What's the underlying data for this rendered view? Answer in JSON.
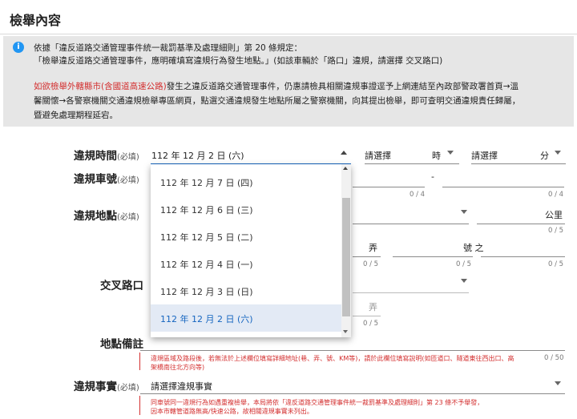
{
  "page": {
    "title": "檢舉內容"
  },
  "notice": {
    "line1": "依據「違反道路交通管理事件統一裁罰基準及處理細則」第 20 條規定：",
    "line2": "「檢舉違反道路交通管理事件，應明確填寫違規行為發生地點。」(如該車輛於「路口」違規，請選擇 交叉路口)",
    "line3_red": "如欲檢舉外轄縣市(含國道高速公路)",
    "line3_rest": "發生之違反道路交通管理事件，仍惠請檢具相關違規事證逕予上網連結至內政部警政署首頁→溫",
    "line4": "馨關懷→各警察機關交通違規檢舉專區網頁，點選交通違規發生地點所屬之警察機關，向其提出檢舉，即可查明交通違規責任歸屬，",
    "line5": "暨避免處理期程延宕。"
  },
  "form": {
    "required_tag": "(必填)",
    "time": {
      "label": "違規時間",
      "date_value": "112 年 12 月 2 日 (六)",
      "hour_placeholder": "請選擇",
      "hour_unit": "時",
      "minute_placeholder": "請選擇",
      "minute_unit": "分"
    },
    "plate": {
      "label": "違規車號",
      "separator": "-",
      "counter1": "0 / 4",
      "counter2": "0 / 4"
    },
    "location": {
      "label": "違規地點",
      "km_unit": "公里",
      "counter_km": "0 / 5",
      "lane_unit": "弄",
      "number_unit": "號 之",
      "counter_a": "0 / 5",
      "counter_b": "0 / 5",
      "counter_c": "0 / 5"
    },
    "intersection": {
      "label": "交叉路口",
      "lane_unit": "弄",
      "counter": "0 / 5"
    },
    "remark": {
      "label": "地點備註",
      "hint": "違規區域及路段後，若無法於上述欄位填寫詳細地址(巷、弄、號、KM等)，請於此欄位填寫說明(如匝道口、隧道東往西出口、高",
      "hint2": "架橋南往北方向等)",
      "counter": "0 / 50"
    },
    "fact": {
      "label": "違規事實",
      "placeholder": "請選擇違規事實",
      "hint1": "同車號同一違規行為如遇重複檢舉，本局將依「違反道路交通管理事件統一裁罰基準及處理細則」第 23 條不予舉發，",
      "hint2": "因本市轄管道路無高/快速公路，故相關違規事實未列出。"
    }
  },
  "date_dropdown": {
    "options": [
      "112 年 12 月 7 日 (四)",
      "112 年 12 月 6 日 (三)",
      "112 年 12 月 5 日 (二)",
      "112 年 12 月 4 日 (一)",
      "112 年 12 月 3 日 (日)",
      "112 年 12 月 2 日 (六)"
    ],
    "selected_index": 5
  },
  "colors": {
    "accent": "#1565c0",
    "error": "#d32f2f",
    "info": "#2196f3",
    "selected_bg": "#e3eaf5"
  },
  "icons": {
    "notice": "info-icon",
    "dropdown": "caret-down-icon",
    "dropdown_open": "caret-up-icon"
  }
}
